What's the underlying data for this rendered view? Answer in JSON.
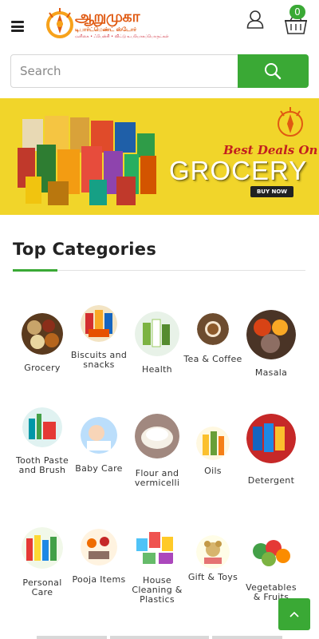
{
  "header": {
    "logo_title": "ஆறுமுகா",
    "logo_subtitle": "டிபார்ட்மெண்ட் ஸ்டோர்",
    "logo_tagline": "மளிகை • ஃபேன்சி • விட்டு உபயோகப்பொருட்கள்",
    "cart_count": "0"
  },
  "search": {
    "placeholder": "Search"
  },
  "banner": {
    "headline": "Best Deals On",
    "title": "GROCERY",
    "button": "BUY NOW"
  },
  "section": {
    "title": "Top Categories"
  },
  "categories": [
    {
      "label": "Grocery",
      "image": "grocery-image"
    },
    {
      "label": "Biscuits and snacks",
      "image": "biscuits-image"
    },
    {
      "label": "Health",
      "image": "health-image"
    },
    {
      "label": "Tea & Coffee",
      "image": "tea-coffee-image"
    },
    {
      "label": "Masala",
      "image": "masala-image"
    },
    {
      "label": "Tooth Paste and Brush",
      "image": "toothpaste-image"
    },
    {
      "label": "Baby Care",
      "image": "baby-care-image"
    },
    {
      "label": "Flour and vermicelli",
      "image": "flour-image"
    },
    {
      "label": "Oils",
      "image": "oils-image"
    },
    {
      "label": "Detergent",
      "image": "detergent-image"
    },
    {
      "label": "Personal Care",
      "image": "personal-care-image"
    },
    {
      "label": "Pooja Items",
      "image": "pooja-image"
    },
    {
      "label": "House Cleaning & Plastics",
      "image": "house-cleaning-image"
    },
    {
      "label": "Gift & Toys",
      "image": "gift-toys-image"
    },
    {
      "label": "Vegetables & Fruits",
      "image": "vegetables-image"
    }
  ],
  "colors": {
    "accent": "#3aa935",
    "banner_bg": "#f1d52a",
    "brand_orange": "#e05a12"
  }
}
